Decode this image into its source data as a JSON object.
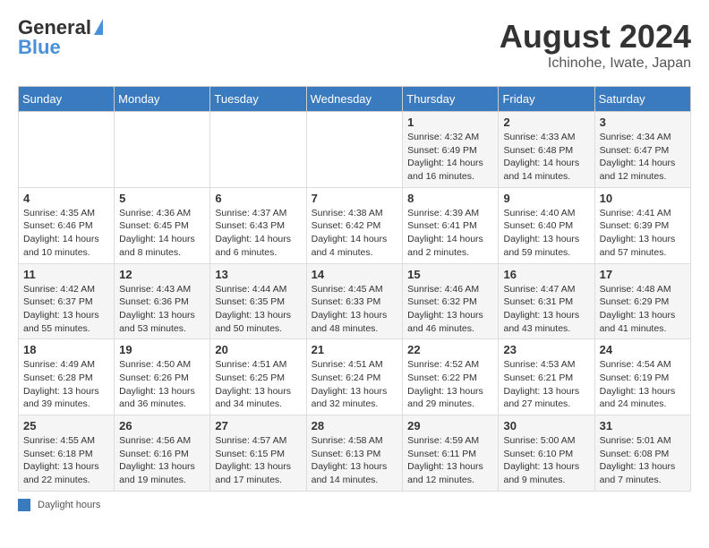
{
  "header": {
    "logo_general": "General",
    "logo_blue": "Blue",
    "title": "August 2024",
    "subtitle": "Ichinohe, Iwate, Japan"
  },
  "weekdays": [
    "Sunday",
    "Monday",
    "Tuesday",
    "Wednesday",
    "Thursday",
    "Friday",
    "Saturday"
  ],
  "weeks": [
    [
      {
        "day": "",
        "info": ""
      },
      {
        "day": "",
        "info": ""
      },
      {
        "day": "",
        "info": ""
      },
      {
        "day": "",
        "info": ""
      },
      {
        "day": "1",
        "info": "Sunrise: 4:32 AM\nSunset: 6:49 PM\nDaylight: 14 hours and 16 minutes."
      },
      {
        "day": "2",
        "info": "Sunrise: 4:33 AM\nSunset: 6:48 PM\nDaylight: 14 hours and 14 minutes."
      },
      {
        "day": "3",
        "info": "Sunrise: 4:34 AM\nSunset: 6:47 PM\nDaylight: 14 hours and 12 minutes."
      }
    ],
    [
      {
        "day": "4",
        "info": "Sunrise: 4:35 AM\nSunset: 6:46 PM\nDaylight: 14 hours and 10 minutes."
      },
      {
        "day": "5",
        "info": "Sunrise: 4:36 AM\nSunset: 6:45 PM\nDaylight: 14 hours and 8 minutes."
      },
      {
        "day": "6",
        "info": "Sunrise: 4:37 AM\nSunset: 6:43 PM\nDaylight: 14 hours and 6 minutes."
      },
      {
        "day": "7",
        "info": "Sunrise: 4:38 AM\nSunset: 6:42 PM\nDaylight: 14 hours and 4 minutes."
      },
      {
        "day": "8",
        "info": "Sunrise: 4:39 AM\nSunset: 6:41 PM\nDaylight: 14 hours and 2 minutes."
      },
      {
        "day": "9",
        "info": "Sunrise: 4:40 AM\nSunset: 6:40 PM\nDaylight: 13 hours and 59 minutes."
      },
      {
        "day": "10",
        "info": "Sunrise: 4:41 AM\nSunset: 6:39 PM\nDaylight: 13 hours and 57 minutes."
      }
    ],
    [
      {
        "day": "11",
        "info": "Sunrise: 4:42 AM\nSunset: 6:37 PM\nDaylight: 13 hours and 55 minutes."
      },
      {
        "day": "12",
        "info": "Sunrise: 4:43 AM\nSunset: 6:36 PM\nDaylight: 13 hours and 53 minutes."
      },
      {
        "day": "13",
        "info": "Sunrise: 4:44 AM\nSunset: 6:35 PM\nDaylight: 13 hours and 50 minutes."
      },
      {
        "day": "14",
        "info": "Sunrise: 4:45 AM\nSunset: 6:33 PM\nDaylight: 13 hours and 48 minutes."
      },
      {
        "day": "15",
        "info": "Sunrise: 4:46 AM\nSunset: 6:32 PM\nDaylight: 13 hours and 46 minutes."
      },
      {
        "day": "16",
        "info": "Sunrise: 4:47 AM\nSunset: 6:31 PM\nDaylight: 13 hours and 43 minutes."
      },
      {
        "day": "17",
        "info": "Sunrise: 4:48 AM\nSunset: 6:29 PM\nDaylight: 13 hours and 41 minutes."
      }
    ],
    [
      {
        "day": "18",
        "info": "Sunrise: 4:49 AM\nSunset: 6:28 PM\nDaylight: 13 hours and 39 minutes."
      },
      {
        "day": "19",
        "info": "Sunrise: 4:50 AM\nSunset: 6:26 PM\nDaylight: 13 hours and 36 minutes."
      },
      {
        "day": "20",
        "info": "Sunrise: 4:51 AM\nSunset: 6:25 PM\nDaylight: 13 hours and 34 minutes."
      },
      {
        "day": "21",
        "info": "Sunrise: 4:51 AM\nSunset: 6:24 PM\nDaylight: 13 hours and 32 minutes."
      },
      {
        "day": "22",
        "info": "Sunrise: 4:52 AM\nSunset: 6:22 PM\nDaylight: 13 hours and 29 minutes."
      },
      {
        "day": "23",
        "info": "Sunrise: 4:53 AM\nSunset: 6:21 PM\nDaylight: 13 hours and 27 minutes."
      },
      {
        "day": "24",
        "info": "Sunrise: 4:54 AM\nSunset: 6:19 PM\nDaylight: 13 hours and 24 minutes."
      }
    ],
    [
      {
        "day": "25",
        "info": "Sunrise: 4:55 AM\nSunset: 6:18 PM\nDaylight: 13 hours and 22 minutes."
      },
      {
        "day": "26",
        "info": "Sunrise: 4:56 AM\nSunset: 6:16 PM\nDaylight: 13 hours and 19 minutes."
      },
      {
        "day": "27",
        "info": "Sunrise: 4:57 AM\nSunset: 6:15 PM\nDaylight: 13 hours and 17 minutes."
      },
      {
        "day": "28",
        "info": "Sunrise: 4:58 AM\nSunset: 6:13 PM\nDaylight: 13 hours and 14 minutes."
      },
      {
        "day": "29",
        "info": "Sunrise: 4:59 AM\nSunset: 6:11 PM\nDaylight: 13 hours and 12 minutes."
      },
      {
        "day": "30",
        "info": "Sunrise: 5:00 AM\nSunset: 6:10 PM\nDaylight: 13 hours and 9 minutes."
      },
      {
        "day": "31",
        "info": "Sunrise: 5:01 AM\nSunset: 6:08 PM\nDaylight: 13 hours and 7 minutes."
      }
    ]
  ],
  "footer": {
    "label": "Daylight hours"
  }
}
